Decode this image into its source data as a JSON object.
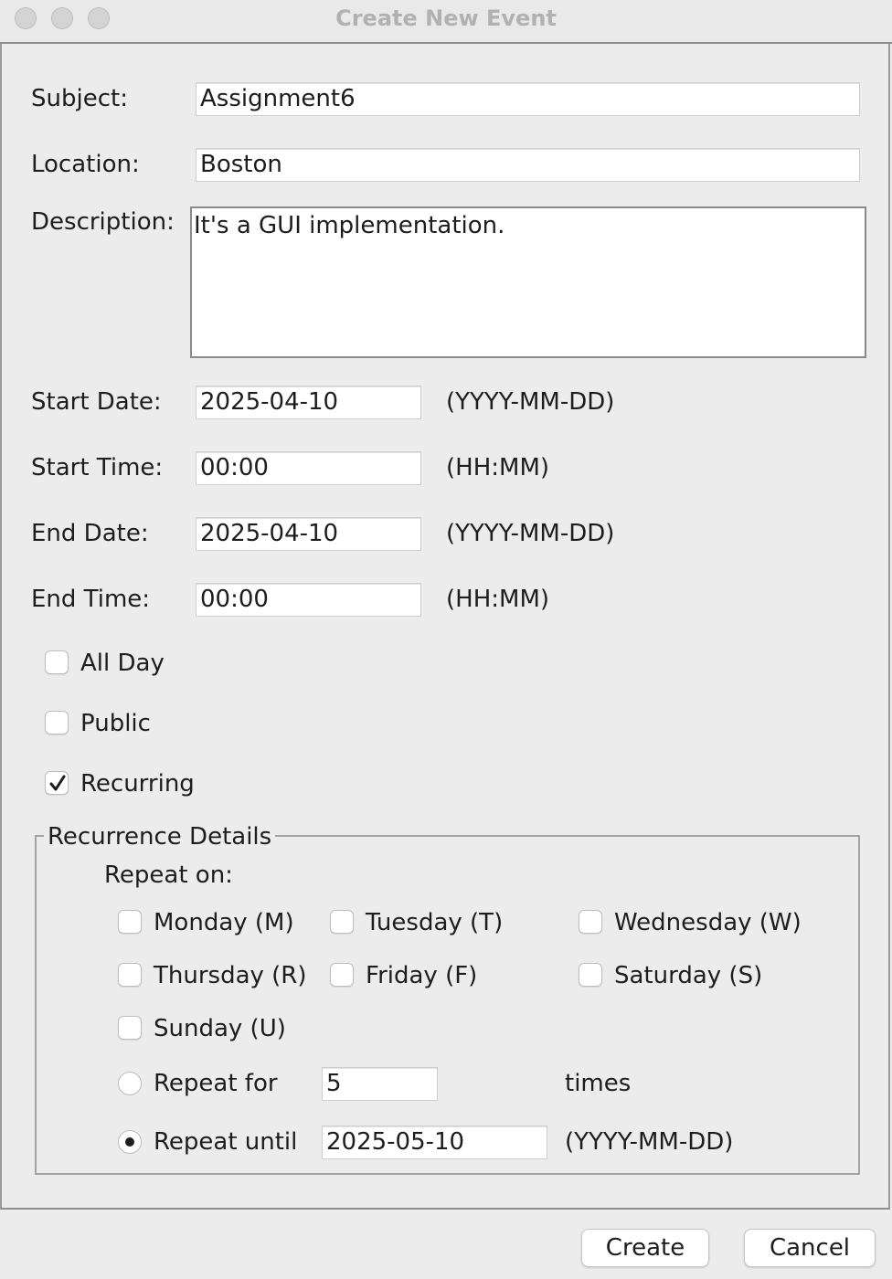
{
  "window": {
    "title": "Create New Event"
  },
  "form": {
    "subject": {
      "label": "Subject:",
      "value": "Assignment6"
    },
    "location": {
      "label": "Location:",
      "value": "Boston"
    },
    "description": {
      "label": "Description:",
      "value": "It's a GUI implementation."
    },
    "start_date": {
      "label": "Start Date:",
      "value": "2025-04-10",
      "hint": "(YYYY-MM-DD)"
    },
    "start_time": {
      "label": "Start Time:",
      "value": "00:00",
      "hint": "(HH:MM)"
    },
    "end_date": {
      "label": "End Date:",
      "value": "2025-04-10",
      "hint": "(YYYY-MM-DD)"
    },
    "end_time": {
      "label": "End Time:",
      "value": "00:00",
      "hint": "(HH:MM)"
    },
    "all_day": {
      "label": "All Day",
      "checked": false
    },
    "public": {
      "label": "Public",
      "checked": false
    },
    "recurring": {
      "label": "Recurring",
      "checked": true
    }
  },
  "recurrence": {
    "title": "Recurrence Details",
    "repeat_on_label": "Repeat on:",
    "days": [
      {
        "label": "Monday (M)",
        "checked": false
      },
      {
        "label": "Tuesday (T)",
        "checked": false
      },
      {
        "label": "Wednesday (W)",
        "checked": false
      },
      {
        "label": "Thursday (R)",
        "checked": false
      },
      {
        "label": "Friday (F)",
        "checked": false
      },
      {
        "label": "Saturday (S)",
        "checked": false
      },
      {
        "label": "Sunday (U)",
        "checked": false
      }
    ],
    "repeat_for": {
      "label": "Repeat for",
      "value": "5",
      "suffix": "times",
      "selected": false
    },
    "repeat_until": {
      "label": "Repeat until",
      "value": "2025-05-10",
      "hint": "(YYYY-MM-DD)",
      "selected": true
    }
  },
  "buttons": {
    "create": "Create",
    "cancel": "Cancel"
  }
}
